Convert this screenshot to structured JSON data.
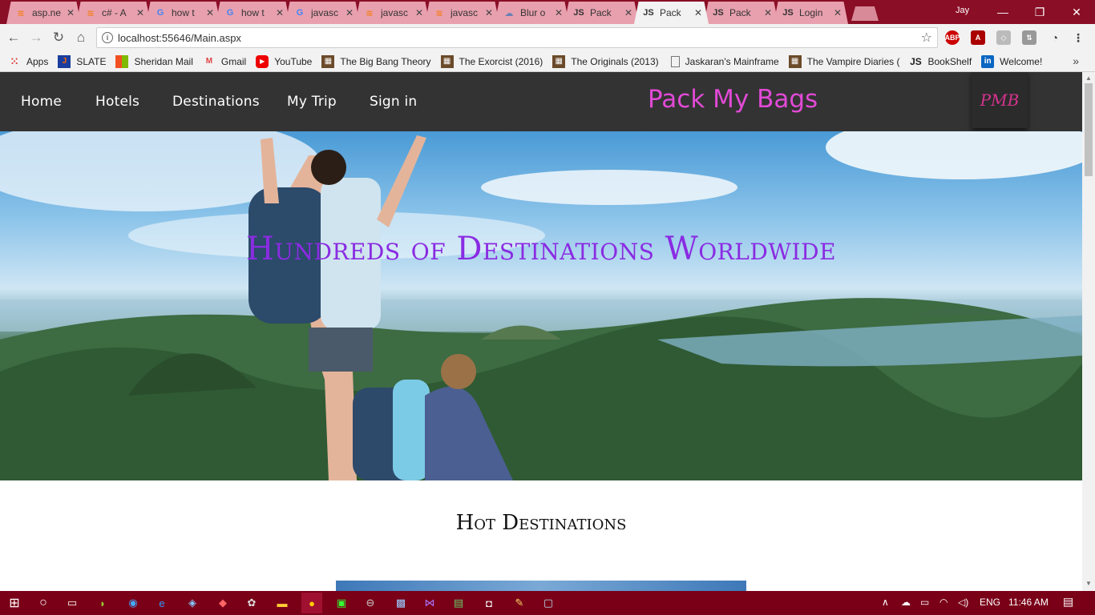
{
  "browser": {
    "tabs": [
      {
        "title": "asp.ne",
        "icon": "stackoverflow-icon",
        "active": false
      },
      {
        "title": "c# - A",
        "icon": "stackoverflow-icon",
        "active": false
      },
      {
        "title": "how t",
        "icon": "google-icon",
        "active": false
      },
      {
        "title": "how t",
        "icon": "google-icon",
        "active": false
      },
      {
        "title": "javasc",
        "icon": "google-icon",
        "active": false
      },
      {
        "title": "javasc",
        "icon": "stackoverflow-icon",
        "active": false
      },
      {
        "title": "javasc",
        "icon": "stackoverflow-icon",
        "active": false
      },
      {
        "title": "Blur o",
        "icon": "cloud-icon",
        "active": false
      },
      {
        "title": "Pack",
        "icon": "js-icon",
        "active": false
      },
      {
        "title": "Pack",
        "icon": "js-icon",
        "active": true
      },
      {
        "title": "Pack",
        "icon": "js-icon",
        "active": false
      },
      {
        "title": "Login",
        "icon": "js-icon",
        "active": false
      }
    ],
    "profile_name": "Jay",
    "url": "localhost:55646/Main.aspx",
    "colors": {
      "titlebar": "#8a0e26",
      "toolbar": "#f2f2f2"
    },
    "bookmarks": [
      {
        "label": "Apps",
        "icon": "apps-grid-icon"
      },
      {
        "label": "SLATE",
        "icon": "slate-icon"
      },
      {
        "label": "Sheridan Mail",
        "icon": "microsoft-icon"
      },
      {
        "label": "Gmail",
        "icon": "gmail-icon"
      },
      {
        "label": "YouTube",
        "icon": "youtube-icon"
      },
      {
        "label": "The Big Bang Theory",
        "icon": "film-icon"
      },
      {
        "label": "The Exorcist (2016)",
        "icon": "film-icon"
      },
      {
        "label": "The Originals (2013)",
        "icon": "film-icon"
      },
      {
        "label": "Jaskaran's Mainframe",
        "icon": "page-icon"
      },
      {
        "label": "The Vampire Diaries (",
        "icon": "film-icon"
      },
      {
        "label": "BookShelf",
        "icon": "js-icon"
      },
      {
        "label": "Welcome!",
        "icon": "linkedin-icon"
      }
    ]
  },
  "site": {
    "nav": [
      "Home",
      "Hotels",
      "Destinations",
      "My Trip",
      "Sign in"
    ],
    "brand": "Pack My Bags",
    "logo_text": "PMB",
    "hero_title": "Hundreds of Destinations Worldwide",
    "section_title": "Hot Destinations",
    "colors": {
      "nav_bg": "#333333",
      "brand": "#e24ad6",
      "hero_title": "#8a2be2"
    }
  },
  "taskbar": {
    "language": "ENG",
    "time": "11:46 AM",
    "color": "#7a0018"
  }
}
